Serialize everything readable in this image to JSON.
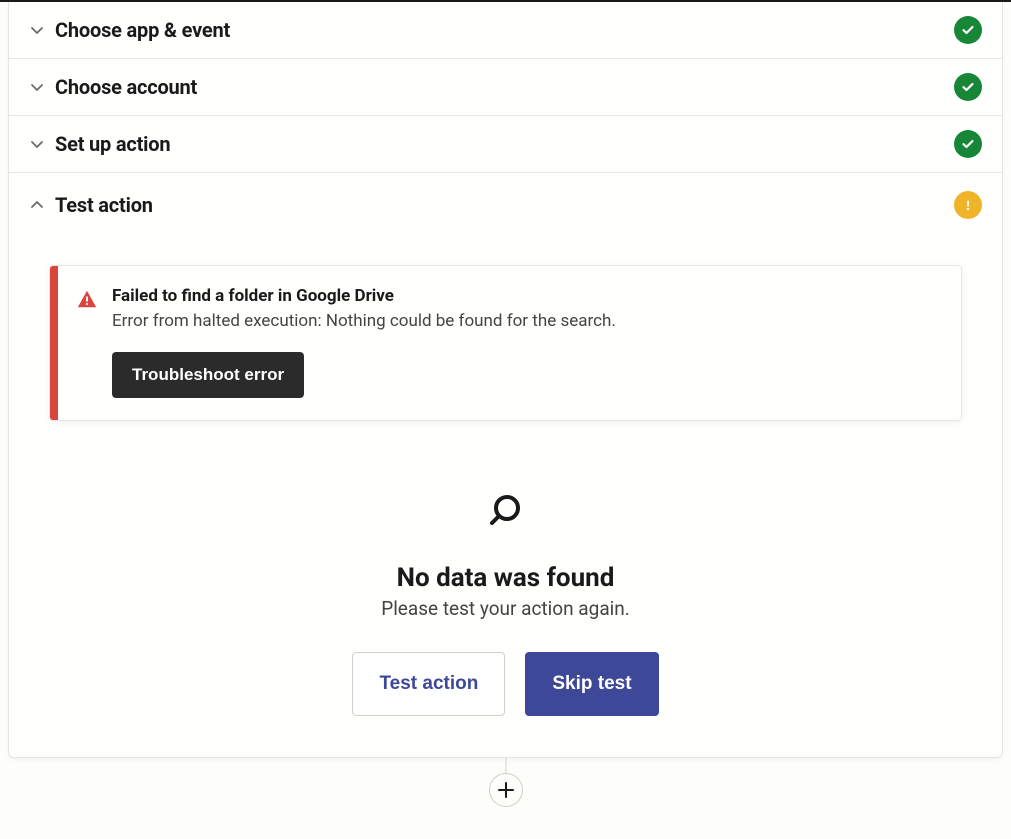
{
  "steps": [
    {
      "label": "Choose app & event",
      "status": "success",
      "expanded": false
    },
    {
      "label": "Choose account",
      "status": "success",
      "expanded": false
    },
    {
      "label": "Set up action",
      "status": "success",
      "expanded": false
    },
    {
      "label": "Test action",
      "status": "warning",
      "expanded": true
    }
  ],
  "error": {
    "title": "Failed to find a folder in Google Drive",
    "message": "Error from halted execution: Nothing could be found for the search.",
    "button": "Troubleshoot error"
  },
  "empty": {
    "title": "No data was found",
    "subtitle": "Please test your action again.",
    "test_button": "Test action",
    "skip_button": "Skip test"
  }
}
